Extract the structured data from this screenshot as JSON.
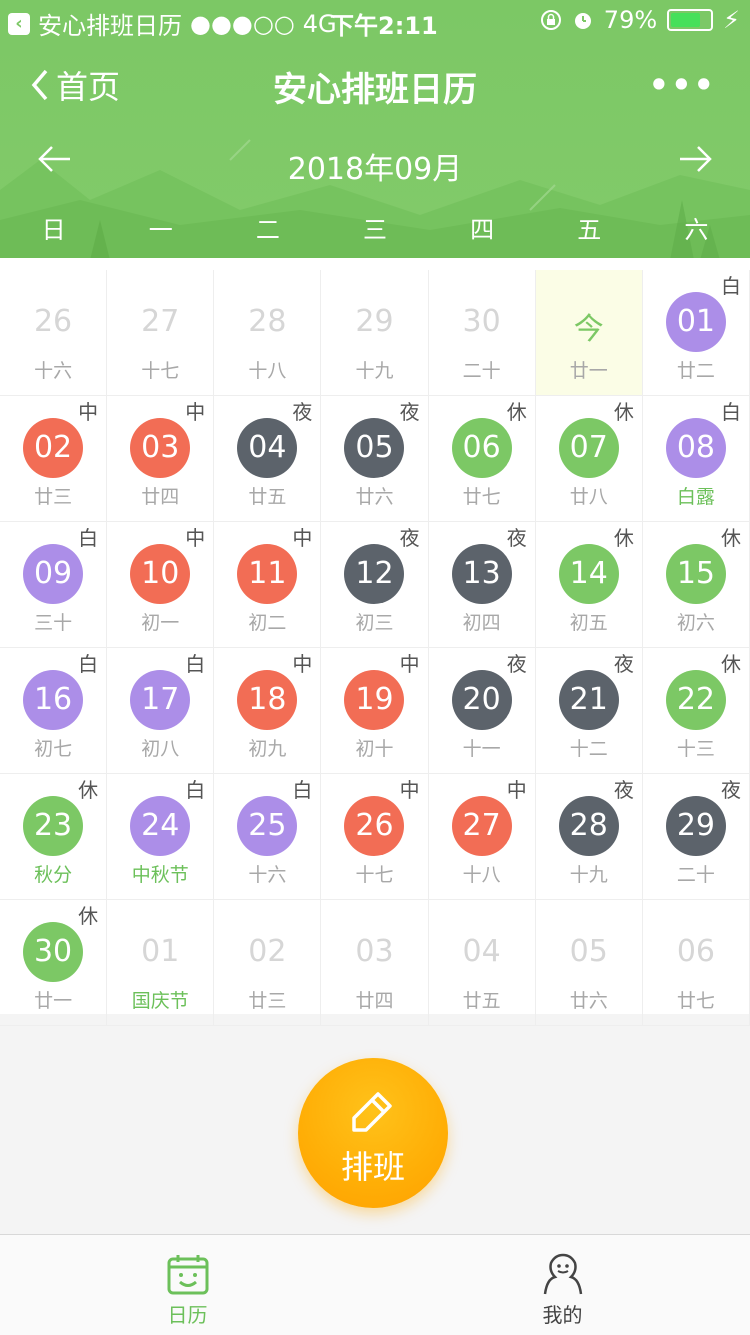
{
  "status_bar": {
    "app_name": "安心排班日历",
    "signal": "●●●○○",
    "network": "4G",
    "time": "下午2:11",
    "battery": "79%",
    "battery_level": 0.79
  },
  "nav": {
    "back_label": "首页",
    "title": "安心排班日历",
    "more": "•••"
  },
  "month": {
    "label": "2018年09月"
  },
  "weekdays": [
    "日",
    "一",
    "二",
    "三",
    "四",
    "五",
    "六"
  ],
  "colors": {
    "day": "#ac8ee8",
    "mid": "#f26d55",
    "night": "#5c636b",
    "rest": "#7cc865"
  },
  "days": [
    {
      "num": "26",
      "lunar": "十六",
      "shift": "",
      "type": "dim"
    },
    {
      "num": "27",
      "lunar": "十七",
      "shift": "",
      "type": "dim"
    },
    {
      "num": "28",
      "lunar": "十八",
      "shift": "",
      "type": "dim"
    },
    {
      "num": "29",
      "lunar": "十九",
      "shift": "",
      "type": "dim"
    },
    {
      "num": "30",
      "lunar": "二十",
      "shift": "",
      "type": "dim"
    },
    {
      "num": "今",
      "lunar": "廿一",
      "shift": "",
      "type": "today"
    },
    {
      "num": "01",
      "lunar": "廿二",
      "shift": "白",
      "type": "day"
    },
    {
      "num": "02",
      "lunar": "廿三",
      "shift": "中",
      "type": "mid"
    },
    {
      "num": "03",
      "lunar": "廿四",
      "shift": "中",
      "type": "mid"
    },
    {
      "num": "04",
      "lunar": "廿五",
      "shift": "夜",
      "type": "night"
    },
    {
      "num": "05",
      "lunar": "廿六",
      "shift": "夜",
      "type": "night"
    },
    {
      "num": "06",
      "lunar": "廿七",
      "shift": "休",
      "type": "rest"
    },
    {
      "num": "07",
      "lunar": "廿八",
      "shift": "休",
      "type": "rest"
    },
    {
      "num": "08",
      "lunar": "白露",
      "shift": "白",
      "type": "day",
      "festival": true
    },
    {
      "num": "09",
      "lunar": "三十",
      "shift": "白",
      "type": "day"
    },
    {
      "num": "10",
      "lunar": "初一",
      "shift": "中",
      "type": "mid"
    },
    {
      "num": "11",
      "lunar": "初二",
      "shift": "中",
      "type": "mid"
    },
    {
      "num": "12",
      "lunar": "初三",
      "shift": "夜",
      "type": "night"
    },
    {
      "num": "13",
      "lunar": "初四",
      "shift": "夜",
      "type": "night"
    },
    {
      "num": "14",
      "lunar": "初五",
      "shift": "休",
      "type": "rest"
    },
    {
      "num": "15",
      "lunar": "初六",
      "shift": "休",
      "type": "rest"
    },
    {
      "num": "16",
      "lunar": "初七",
      "shift": "白",
      "type": "day"
    },
    {
      "num": "17",
      "lunar": "初八",
      "shift": "白",
      "type": "day"
    },
    {
      "num": "18",
      "lunar": "初九",
      "shift": "中",
      "type": "mid"
    },
    {
      "num": "19",
      "lunar": "初十",
      "shift": "中",
      "type": "mid"
    },
    {
      "num": "20",
      "lunar": "十一",
      "shift": "夜",
      "type": "night"
    },
    {
      "num": "21",
      "lunar": "十二",
      "shift": "夜",
      "type": "night"
    },
    {
      "num": "22",
      "lunar": "十三",
      "shift": "休",
      "type": "rest"
    },
    {
      "num": "23",
      "lunar": "秋分",
      "shift": "休",
      "type": "rest",
      "festival": true
    },
    {
      "num": "24",
      "lunar": "中秋节",
      "shift": "白",
      "type": "day",
      "festival": true
    },
    {
      "num": "25",
      "lunar": "十六",
      "shift": "白",
      "type": "day"
    },
    {
      "num": "26",
      "lunar": "十七",
      "shift": "中",
      "type": "mid"
    },
    {
      "num": "27",
      "lunar": "十八",
      "shift": "中",
      "type": "mid"
    },
    {
      "num": "28",
      "lunar": "十九",
      "shift": "夜",
      "type": "night"
    },
    {
      "num": "29",
      "lunar": "二十",
      "shift": "夜",
      "type": "night"
    },
    {
      "num": "30",
      "lunar": "廿一",
      "shift": "休",
      "type": "rest"
    },
    {
      "num": "01",
      "lunar": "国庆节",
      "shift": "",
      "type": "dim",
      "festival": true
    },
    {
      "num": "02",
      "lunar": "廿三",
      "shift": "",
      "type": "dim"
    },
    {
      "num": "03",
      "lunar": "廿四",
      "shift": "",
      "type": "dim"
    },
    {
      "num": "04",
      "lunar": "廿五",
      "shift": "",
      "type": "dim"
    },
    {
      "num": "05",
      "lunar": "廿六",
      "shift": "",
      "type": "dim"
    },
    {
      "num": "06",
      "lunar": "廿七",
      "shift": "",
      "type": "dim"
    }
  ],
  "fab": {
    "label": "排班",
    "icon": "pencil-icon"
  },
  "tabs": [
    {
      "label": "日历",
      "icon": "calendar-face-icon",
      "active": true,
      "color": "#6cc05a"
    },
    {
      "label": "我的",
      "icon": "user-icon",
      "active": false,
      "color": "#444444"
    }
  ]
}
